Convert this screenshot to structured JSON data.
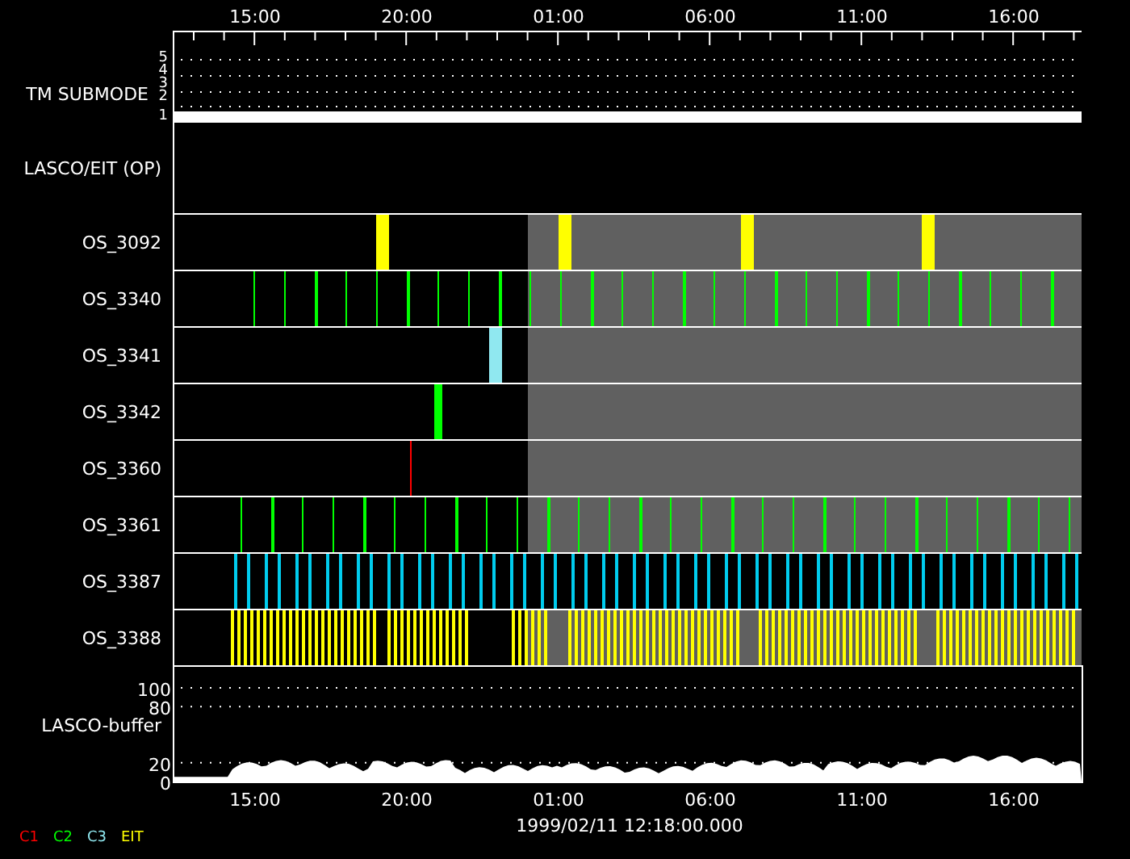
{
  "axis_top": {
    "ticks": [
      "15:00",
      "20:00",
      "01:00",
      "06:00",
      "11:00",
      "16:00"
    ]
  },
  "tm_submode": {
    "label": "TM SUBMODE",
    "levels": [
      "5",
      "4",
      "3",
      "2",
      "1"
    ]
  },
  "lasco_eit": {
    "label": "LASCO/EIT (OP)"
  },
  "rows": [
    {
      "label": "OS_3092",
      "kind": "blocks",
      "color": "#ffff00",
      "shaded": true
    },
    {
      "label": "OS_3340",
      "kind": "ticks",
      "color": "#00ff00",
      "shaded": true
    },
    {
      "label": "OS_3341",
      "kind": "single",
      "color": "#90e8f0",
      "shaded": true
    },
    {
      "label": "OS_3342",
      "kind": "single",
      "color": "#00ff00",
      "shaded": true
    },
    {
      "label": "OS_3360",
      "kind": "line",
      "color": "#ff0000",
      "shaded": true
    },
    {
      "label": "OS_3361",
      "kind": "ticks",
      "color": "#00ff00",
      "shaded": true
    },
    {
      "label": "OS_3387",
      "kind": "pairs",
      "color": "#00ccee",
      "shaded": false
    },
    {
      "label": "OS_3388",
      "kind": "dense",
      "color": "#ffff00",
      "shaded": true
    }
  ],
  "buffer": {
    "label": "LASCO-buffer",
    "ticks": [
      "100",
      "80",
      "20",
      "0"
    ]
  },
  "axis_bottom": {
    "ticks": [
      "15:00",
      "20:00",
      "01:00",
      "06:00",
      "11:00",
      "16:00"
    ]
  },
  "timestamp": "1999/02/11 12:18:00.000",
  "legend": [
    {
      "label": "C1",
      "color": "#ff0000"
    },
    {
      "label": "C2",
      "color": "#00ff00"
    },
    {
      "label": "C3",
      "color": "#90e8f0"
    },
    {
      "label": "EIT",
      "color": "#ffff00"
    }
  ]
}
